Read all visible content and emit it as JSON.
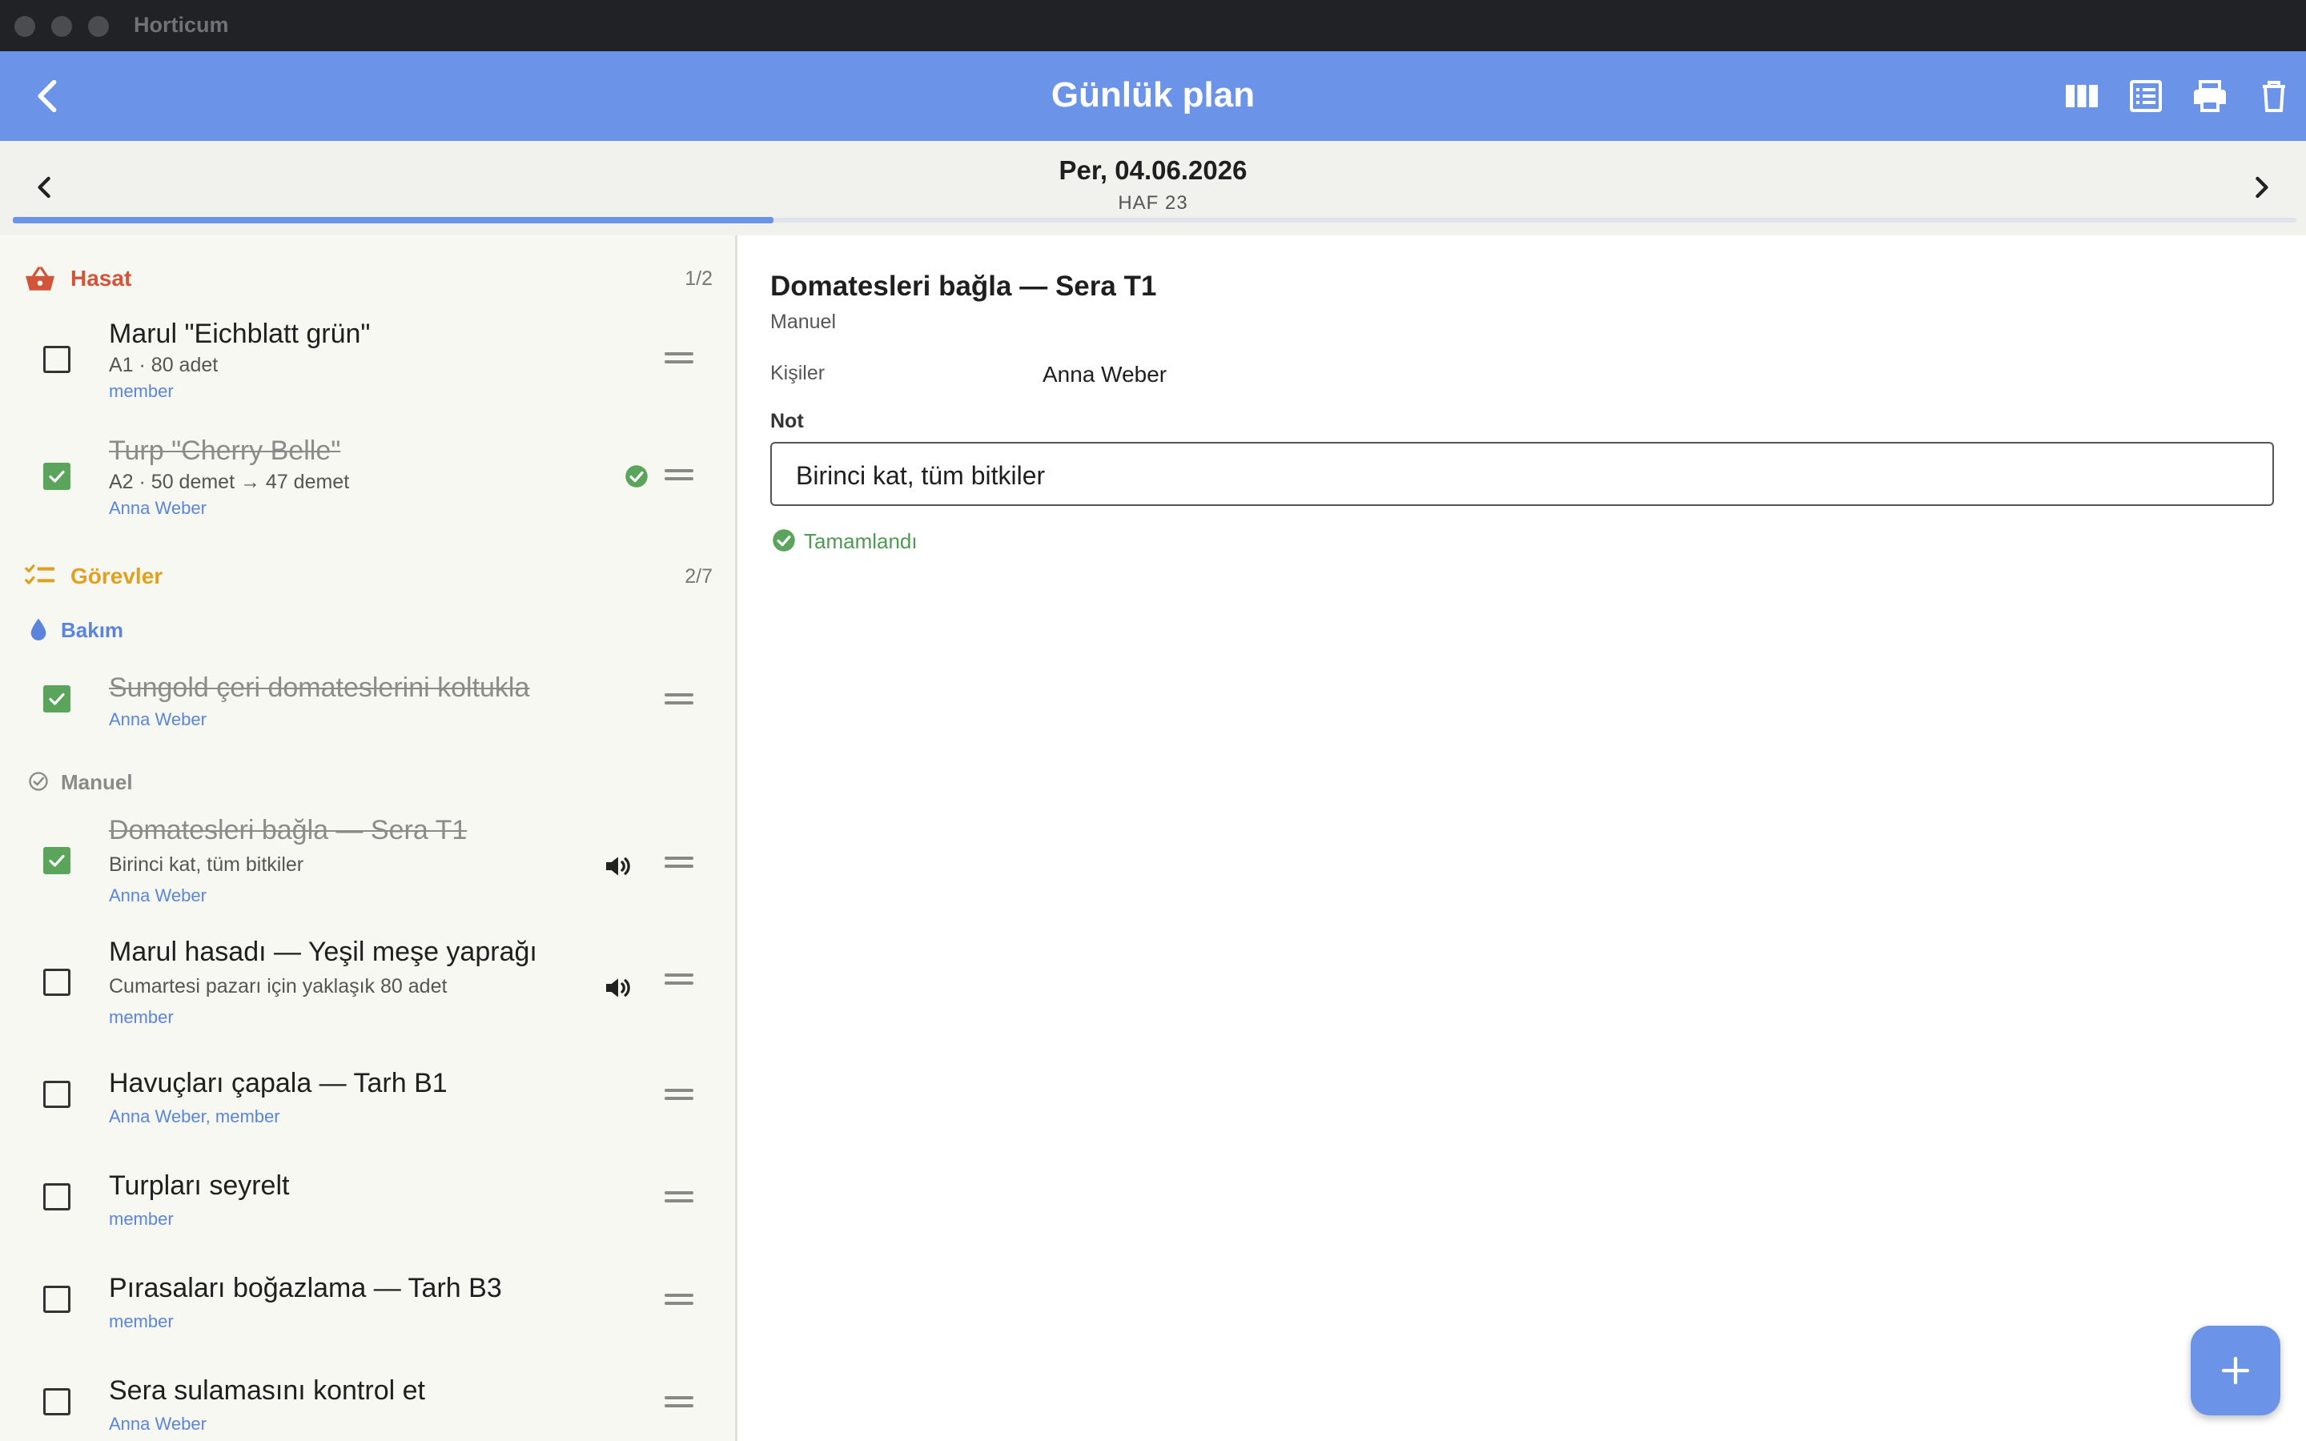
{
  "window": {
    "title": "Horticum"
  },
  "appbar": {
    "title": "Günlük plan"
  },
  "datebar": {
    "date": "Per, 04.06.2026",
    "week": "HAF 23"
  },
  "sections": {
    "harvest": {
      "label": "Hasat",
      "count": "1/2",
      "color": "#d2553b"
    },
    "tasks": {
      "label": "Görevler",
      "count": "2/7",
      "color": "#e0a020"
    }
  },
  "groups": {
    "care": {
      "label": "Bakım",
      "color": "#5b85dc"
    },
    "manual": {
      "label": "Manuel",
      "color": "#8a8a8a"
    }
  },
  "harvest_items": [
    {
      "title": "Marul \"Eichblatt grün\"",
      "subtitle": "A1 · 80 adet",
      "assignee": "member",
      "checked": false
    },
    {
      "title": "Turp \"Cherry Belle\"",
      "subtitle": "A2 · 50 demet → 47 demet",
      "assignee": "Anna Weber",
      "checked": true
    }
  ],
  "care_items": [
    {
      "title": "Sungold çeri domateslerini koltukla",
      "assignee": "Anna Weber",
      "checked": true
    }
  ],
  "manual_items": [
    {
      "title": "Domatesleri bağla — Sera T1",
      "subtitle": "Birinci kat, tüm bitkiler",
      "assignee": "Anna Weber",
      "checked": true
    },
    {
      "title": "Marul hasadı — Yeşil meşe yaprağı",
      "subtitle": "Cumartesi pazarı için yaklaşık 80 adet",
      "assignee": "member",
      "checked": false
    },
    {
      "title": "Havuçları çapala — Tarh B1",
      "assignee": "Anna Weber, member",
      "checked": false
    },
    {
      "title": "Turpları seyrelt",
      "assignee": "member",
      "checked": false
    },
    {
      "title": "Pırasaları boğazlama — Tarh B3",
      "assignee": "member",
      "checked": false
    },
    {
      "title": "Sera sulamasını kontrol et",
      "assignee": "Anna Weber",
      "checked": false
    }
  ],
  "detail": {
    "title": "Domatesleri bağla — Sera T1",
    "source": "Manuel",
    "people_label": "Kişiler",
    "people": "Anna Weber",
    "note_label": "Not",
    "note": "Birinci kat, tüm bitkiler",
    "status": "Tamamlandı"
  },
  "icons": {
    "back": "arrow-back-icon",
    "toolbar": [
      "columns-view-icon",
      "list-view-icon",
      "print-icon",
      "delete-icon"
    ],
    "fab": "add-icon"
  },
  "colors": {
    "accent": "#6b94e9",
    "check": "#5aa45b",
    "assignee": "#5b85dc"
  },
  "progress": 0.333
}
